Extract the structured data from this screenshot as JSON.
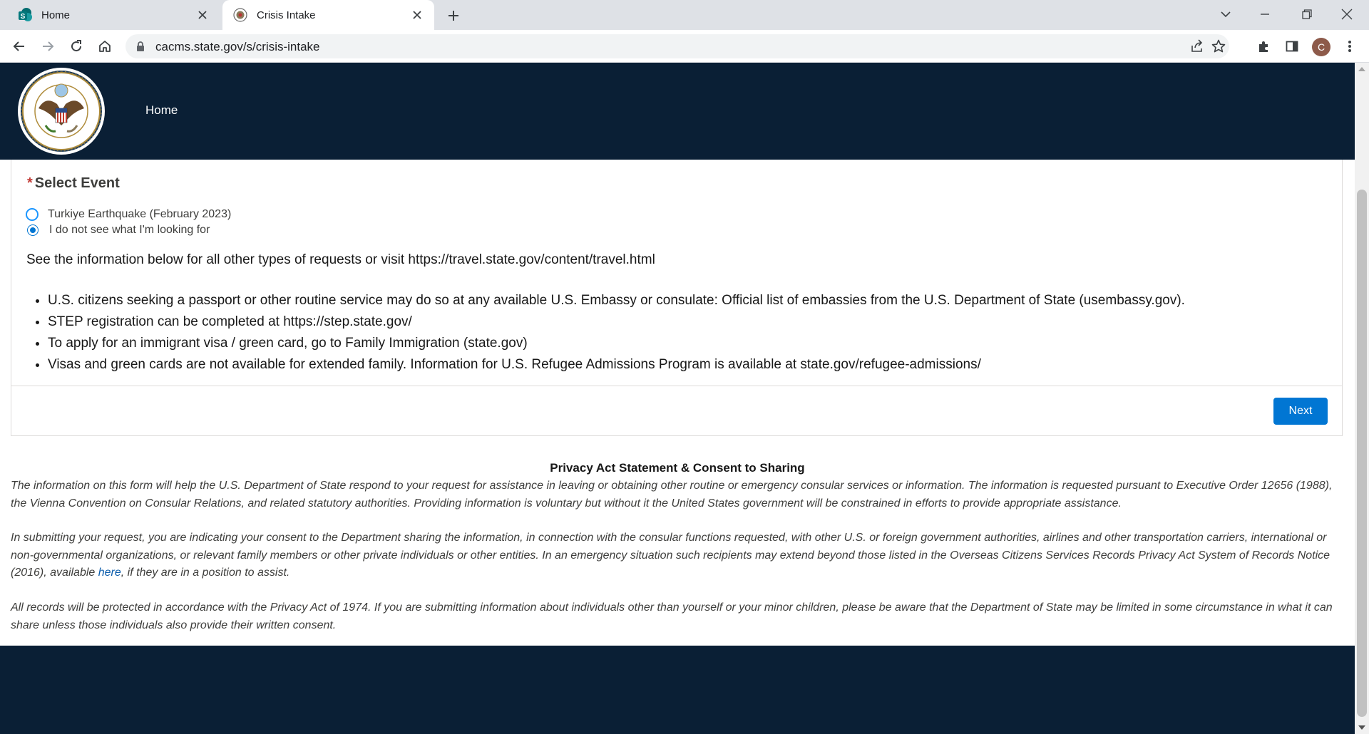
{
  "browser": {
    "tabs": [
      {
        "title": "Home",
        "active": false,
        "favicon": "sharepoint-icon"
      },
      {
        "title": "Crisis Intake",
        "active": true,
        "favicon": "state-seal-icon"
      }
    ],
    "url": "cacms.state.gov/s/crisis-intake",
    "profile_initial": "C"
  },
  "header": {
    "nav_home": "Home",
    "colors": {
      "navy": "#0a1f35"
    }
  },
  "form": {
    "required_mark": "*",
    "label": "Select Event",
    "options": [
      {
        "label": "Turkiye Earthquake (February 2023)",
        "selected": false
      },
      {
        "label": "I do not see what I'm looking for",
        "selected": true
      }
    ],
    "info": "See the information below for all other types of requests or visit https://travel.state.gov/content/travel.html",
    "bullets": [
      "U.S. citizens seeking a passport or other routine service may do so at any available U.S. Embassy or consulate: Official list of embassies from the U.S. Department of State (usembassy.gov).",
      "STEP registration can be completed at https://step.state.gov/",
      "To apply for an immigrant visa / green card, go to Family Immigration (state.gov)",
      "Visas and green cards are not available for extended family. Information for U.S. Refugee Admissions Program is available at state.gov/refugee-admissions/"
    ],
    "next_label": "Next",
    "colors": {
      "primary": "#0176d3"
    }
  },
  "privacy": {
    "title": "Privacy Act Statement & Consent to Sharing",
    "p1": "The information on this form will help the U.S. Department of State respond to your request for assistance in leaving or obtaining other routine or emergency consular services or information. The information is requested pursuant to Executive Order 12656 (1988), the Vienna Convention on Consular Relations, and related statutory authorities. Providing information is voluntary but without it the United States government will be constrained in efforts to provide appropriate assistance.",
    "p2_before": "In submitting your request, you are indicating your consent to the Department sharing the information, in connection with the consular functions requested, with other U.S. or foreign government authorities, airlines and other transportation carriers, international or non-governmental organizations, or relevant family members or other private individuals or other entities. In an emergency situation such recipients may extend beyond those listed in the Overseas Citizens Services Records Privacy Act System of Records Notice (2016), available ",
    "p2_link": "here",
    "p2_after": ", if they are in a position to assist.",
    "p3": "All records will be protected in accordance with the Privacy Act of 1974. If you are submitting information about individuals other than yourself or your minor children, please be aware that the Department of State may be limited in some circumstance in what it can share unless those individuals also provide their written consent."
  }
}
